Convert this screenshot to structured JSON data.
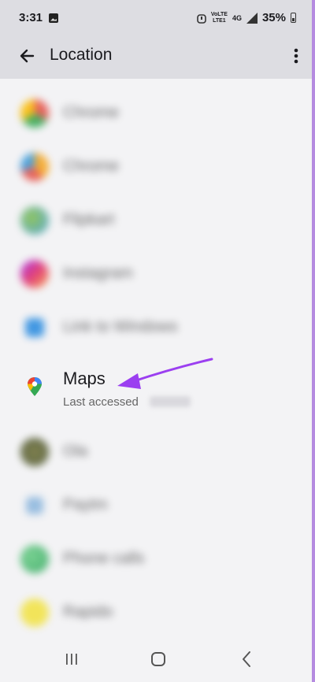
{
  "status_bar": {
    "time": "3:31",
    "network_line1": "VoLTE",
    "network_line2": "LTE1",
    "network_type": "4G",
    "battery": "35%"
  },
  "app_bar": {
    "title": "Location",
    "back_icon": "arrow-left-icon",
    "more_icon": "more-vert-icon"
  },
  "list": {
    "blurred_items": [
      {
        "label": "Chrome",
        "color": "#e5534b"
      },
      {
        "label": "Chrome",
        "color": "#f5a623"
      },
      {
        "label": "Flipkart",
        "color": "#3c9ad9"
      },
      {
        "label": "Instagram",
        "color": "#e1306c"
      },
      {
        "label": "Link to Windows",
        "color": "#2f8ee0"
      }
    ],
    "maps": {
      "label": "Maps",
      "sublabel": "Last accessed"
    },
    "blurred_items_2": [
      {
        "label": "Ola",
        "color": "#5a5a3a"
      },
      {
        "label": "Paytm",
        "color": "#8fb8de"
      },
      {
        "label": "Phone calls",
        "color": "#3dbb6d"
      },
      {
        "label": "Rapido",
        "color": "#f2e34a"
      }
    ]
  },
  "colors": {
    "accent_arrow": "#9b3ff0",
    "frame_border": "#b58be0"
  }
}
